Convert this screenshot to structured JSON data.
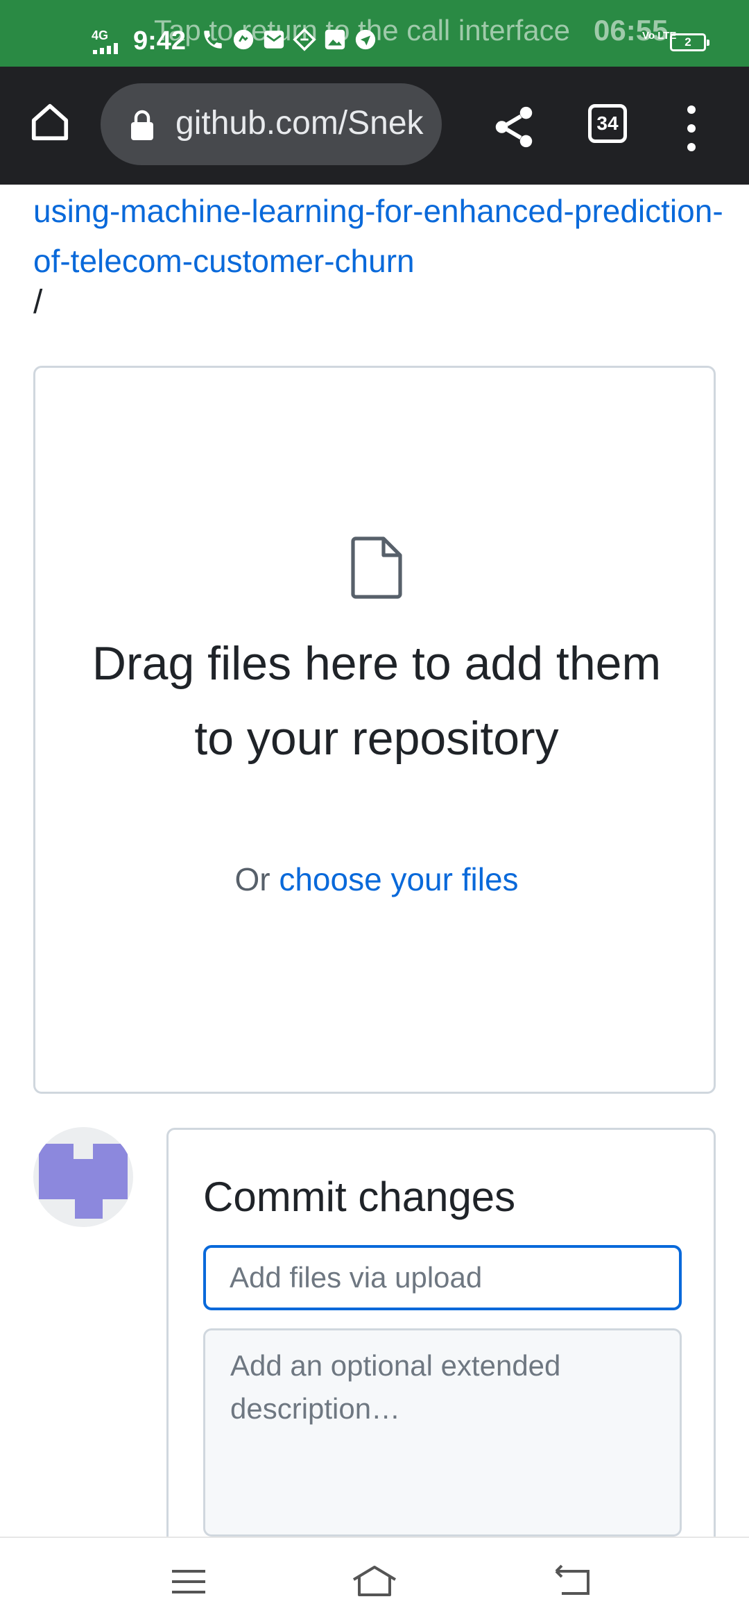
{
  "status_bar": {
    "call_banner": "Tap to return to the call interface",
    "call_time": "06:55",
    "network": "4G",
    "time": "9:42",
    "volte": "Vo LTE",
    "battery": "2"
  },
  "browser": {
    "url": "github.com/Snek",
    "tab_count": "34",
    "icons": [
      "home-icon",
      "lock-icon",
      "share-icon",
      "tab-switcher-icon",
      "more-options-icon"
    ]
  },
  "repo": {
    "link": "using-machine-learning-for-enhanced-prediction-of-telecom-customer-churn",
    "separator": "/"
  },
  "dropzone": {
    "heading": "Drag files here to add them to your repository",
    "or_text": "Or ",
    "choose_link": "choose your files"
  },
  "commit": {
    "title": "Commit changes",
    "summary_placeholder": "Add files via upload",
    "description_placeholder": "Add an optional extended description…"
  },
  "colors": {
    "status_bar": "#2a8a44",
    "toolbar": "#202124",
    "link": "#0969da",
    "focus": "#0969da",
    "avatar": "#8c88dd"
  }
}
